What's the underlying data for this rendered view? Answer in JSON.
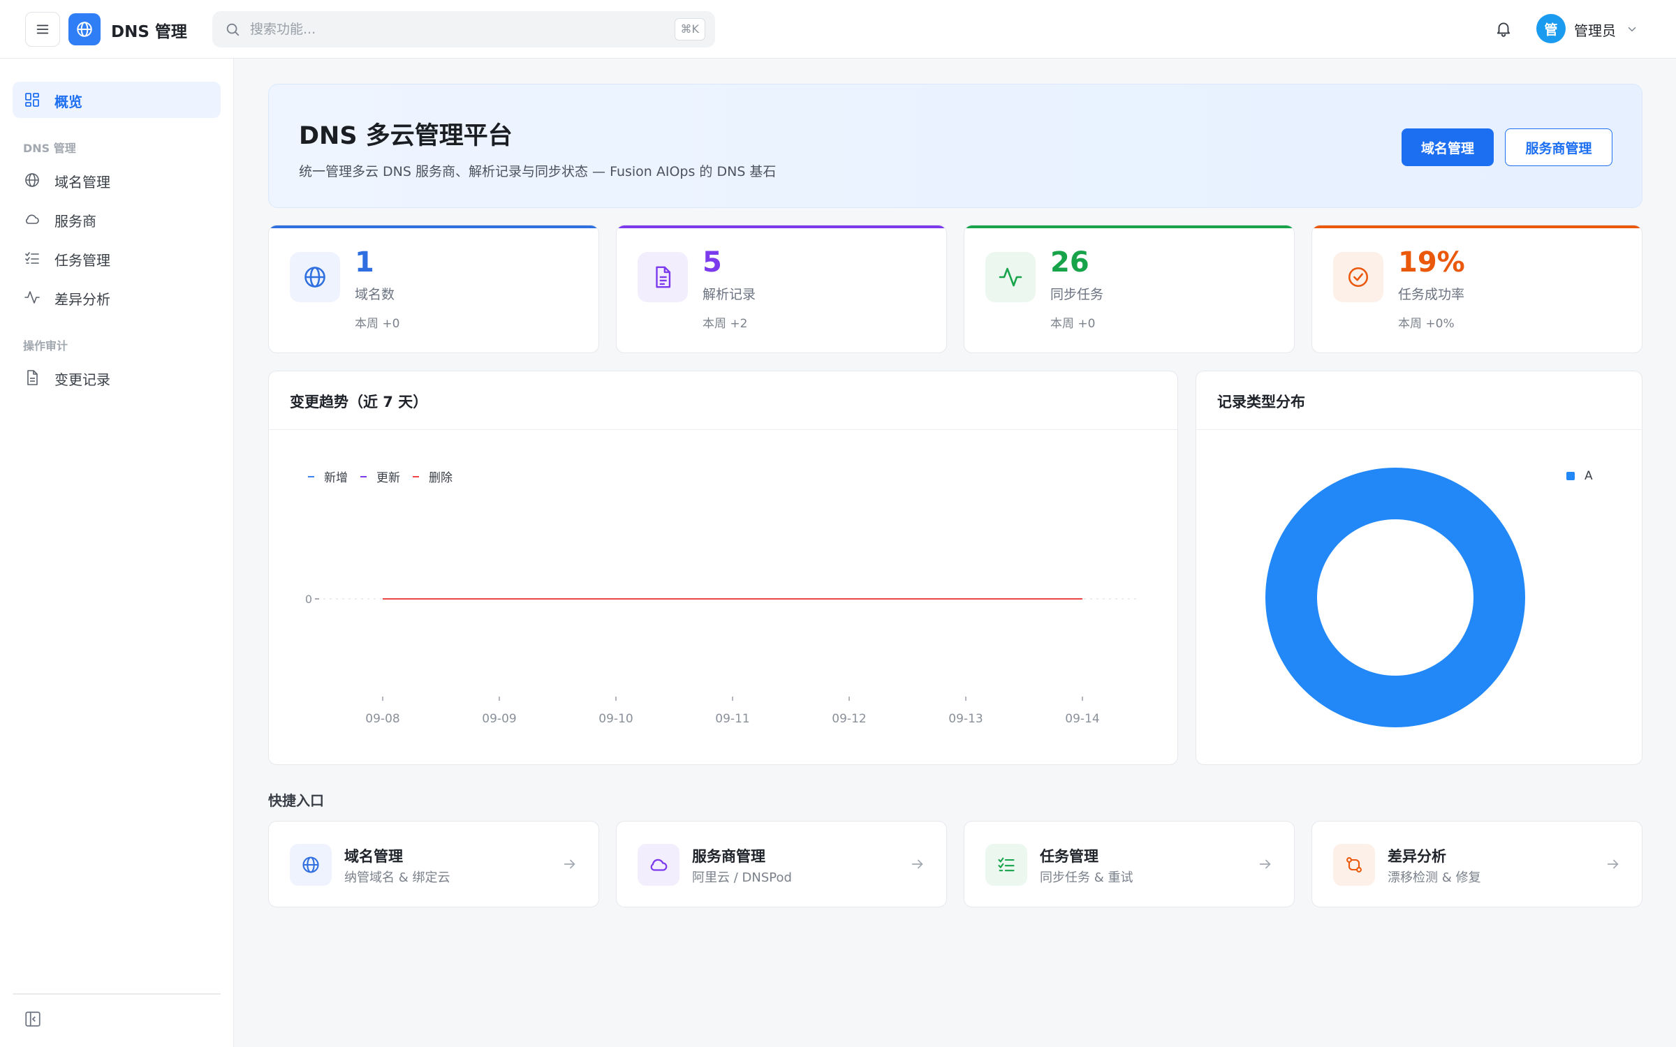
{
  "header": {
    "app_title": "DNS 管理",
    "search_placeholder": "搜索功能...",
    "search_shortcut": "⌘K",
    "user_initial": "管",
    "user_name": "管理员"
  },
  "sidebar": {
    "overview": "概览",
    "group_dns": "DNS 管理",
    "items_dns": [
      {
        "label": "域名管理",
        "icon": "globe-icon"
      },
      {
        "label": "服务商",
        "icon": "cloud-icon"
      },
      {
        "label": "任务管理",
        "icon": "task-list-icon"
      },
      {
        "label": "差异分析",
        "icon": "activity-icon"
      }
    ],
    "group_audit": "操作审计",
    "items_audit": [
      {
        "label": "变更记录",
        "icon": "file-icon"
      }
    ]
  },
  "hero": {
    "title": "DNS 多云管理平台",
    "subtitle": "统一管理多云 DNS 服务商、解析记录与同步状态 — Fusion AIOps 的 DNS 基石",
    "primary_button": "域名管理",
    "secondary_button": "服务商管理"
  },
  "stats": [
    {
      "value": "1",
      "name": "域名数",
      "week": "本周 +0",
      "color": "#2f6fe0",
      "bg": "#eef3fd",
      "icon": "globe-icon"
    },
    {
      "value": "5",
      "name": "解析记录",
      "week": "本周 +2",
      "color": "#7c3aed",
      "bg": "#f3eefd",
      "icon": "file-text-icon"
    },
    {
      "value": "26",
      "name": "同步任务",
      "week": "本周 +0",
      "color": "#16a34a",
      "bg": "#ebf7ef",
      "icon": "activity-icon"
    },
    {
      "value": "19%",
      "name": "任务成功率",
      "week": "本周 +0%",
      "color": "#ea580c",
      "bg": "#fdf0e8",
      "icon": "check-circle-icon"
    }
  ],
  "trend_panel": {
    "title": "变更趋势（近 7 天）"
  },
  "donut_panel": {
    "title": "记录类型分布"
  },
  "chart_data": [
    {
      "type": "line",
      "categories": [
        "09-08",
        "09-09",
        "09-10",
        "09-11",
        "09-12",
        "09-13",
        "09-14"
      ],
      "series": [
        {
          "name": "新增",
          "values": [
            0,
            0,
            0,
            0,
            0,
            0,
            0
          ],
          "color": "#3b82f6"
        },
        {
          "name": "更新",
          "values": [
            0,
            0,
            0,
            0,
            0,
            0,
            0
          ],
          "color": "#7c3aed"
        },
        {
          "name": "删除",
          "values": [
            0,
            0,
            0,
            0,
            0,
            0,
            0
          ],
          "color": "#ef4444"
        }
      ],
      "y_ticks": [
        "0"
      ],
      "legend": "top-left",
      "grid": false
    },
    {
      "type": "pie",
      "style": "donut",
      "labels": [
        "A"
      ],
      "values": [
        5
      ],
      "colors": [
        "#2288f8"
      ],
      "legend": "top-right"
    }
  ],
  "quick": {
    "title": "快捷入口",
    "items": [
      {
        "title": "域名管理",
        "subtitle": "纳管域名 & 绑定云",
        "color": "#2f6fe0",
        "bg": "#eef3fd",
        "icon": "globe-icon"
      },
      {
        "title": "服务商管理",
        "subtitle": "阿里云 / DNSPod",
        "color": "#7c3aed",
        "bg": "#f3eefd",
        "icon": "cloud-icon"
      },
      {
        "title": "任务管理",
        "subtitle": "同步任务 & 重试",
        "color": "#16a34a",
        "bg": "#ebf7ef",
        "icon": "task-list-icon"
      },
      {
        "title": "差异分析",
        "subtitle": "漂移检测 & 修复",
        "color": "#ea580c",
        "bg": "#fdf0e8",
        "icon": "git-compare-icon"
      }
    ]
  }
}
